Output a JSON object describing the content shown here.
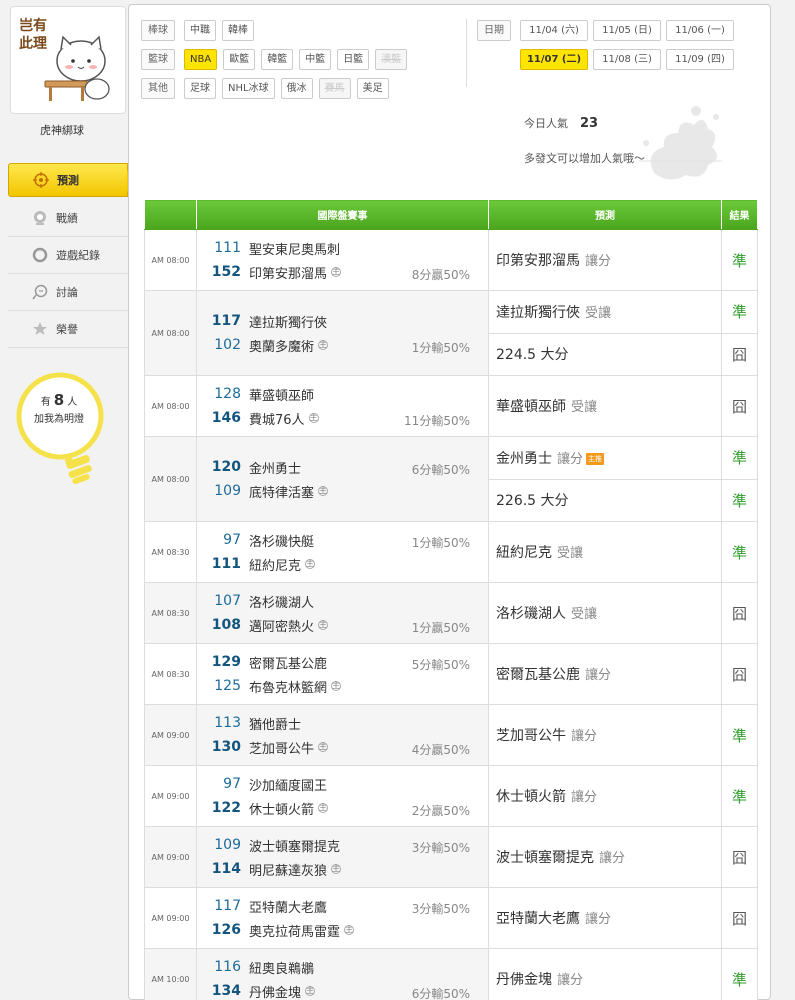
{
  "sidebar": {
    "avatar_text": "岂有此理",
    "username": "虎神綁球",
    "nav": [
      {
        "label": "預測",
        "icon": "target-icon",
        "active": true
      },
      {
        "label": "戰績",
        "icon": "trophy-icon",
        "active": false
      },
      {
        "label": "遊戲紀錄",
        "icon": "ring-icon",
        "active": false
      },
      {
        "label": "討論",
        "icon": "discussion-icon",
        "active": false
      },
      {
        "label": "榮譽",
        "icon": "star-icon",
        "active": false
      }
    ],
    "lamp": {
      "prefix": "有",
      "count": "8",
      "suffix": "人",
      "line2": "加我為明燈"
    }
  },
  "filters": [
    {
      "label": "棒球",
      "items": [
        {
          "text": "中職"
        },
        {
          "text": "韓棒"
        }
      ]
    },
    {
      "label": "籃球",
      "items": [
        {
          "text": "NBA",
          "selected": true
        },
        {
          "text": "歐籃"
        },
        {
          "text": "韓籃"
        },
        {
          "text": "中籃"
        },
        {
          "text": "日籃"
        },
        {
          "text": "澳籃",
          "disabled": true
        }
      ]
    },
    {
      "label": "其他",
      "items": [
        {
          "text": "足球"
        },
        {
          "text": "NHL冰球"
        },
        {
          "text": "俄冰"
        },
        {
          "text": "賽馬",
          "disabled": true
        },
        {
          "text": "美足"
        }
      ]
    }
  ],
  "dates": {
    "label": "日期",
    "row1": [
      {
        "text": "11/04 (六)"
      },
      {
        "text": "11/05 (日)"
      },
      {
        "text": "11/06 (一)"
      }
    ],
    "row2": [
      {
        "text": "11/07 (二)",
        "selected": true
      },
      {
        "text": "11/08 (三)"
      },
      {
        "text": "11/09 (四)"
      }
    ]
  },
  "popularity": {
    "label": "今日人氣",
    "value": "23",
    "note": "多發文可以增加人氣哦～"
  },
  "table": {
    "headers": [
      "",
      "國際盤賽事",
      "預測",
      "結果"
    ],
    "host_mark": "主",
    "badge": "主推",
    "games": [
      {
        "time": "AM 08:00",
        "away": {
          "num": "111",
          "name": "聖安東尼奧馬刺"
        },
        "home": {
          "num": "152",
          "name": "印第安那溜馬"
        },
        "spread": "8分贏50%",
        "spread_row": 2,
        "picks": [
          {
            "team": "印第安那溜馬",
            "type": "讓分",
            "result": "準",
            "win": true
          }
        ]
      },
      {
        "time": "AM 08:00",
        "away": {
          "num": "117",
          "name": "達拉斯獨行俠"
        },
        "home": {
          "num": "102",
          "name": "奧蘭多魔術"
        },
        "spread": "1分輸50%",
        "spread_row": 2,
        "bold_away": true,
        "picks": [
          {
            "team": "達拉斯獨行俠",
            "type": "受讓",
            "result": "準",
            "win": true
          },
          {
            "team": "224.5 大分",
            "type": "",
            "result": "囧",
            "win": false
          }
        ]
      },
      {
        "time": "AM 08:00",
        "away": {
          "num": "128",
          "name": "華盛頓巫師"
        },
        "home": {
          "num": "146",
          "name": "費城76人"
        },
        "spread": "11分輸50%",
        "spread_row": 2,
        "picks": [
          {
            "team": "華盛頓巫師",
            "type": "受讓",
            "result": "囧",
            "win": false
          }
        ]
      },
      {
        "time": "AM 08:00",
        "away": {
          "num": "120",
          "name": "金州勇士"
        },
        "home": {
          "num": "109",
          "name": "底特律活塞"
        },
        "spread": "6分輸50%",
        "spread_row": 1,
        "bold_away": true,
        "picks": [
          {
            "team": "金州勇士",
            "type": "讓分",
            "badge": true,
            "result": "準",
            "win": true
          },
          {
            "team": "226.5 大分",
            "type": "",
            "result": "準",
            "win": true
          }
        ]
      },
      {
        "time": "AM 08:30",
        "away": {
          "num": "97",
          "name": "洛杉磯快艇"
        },
        "home": {
          "num": "111",
          "name": "紐約尼克"
        },
        "spread": "1分輸50%",
        "spread_row": 1,
        "picks": [
          {
            "team": "紐約尼克",
            "type": "受讓",
            "result": "準",
            "win": true
          }
        ]
      },
      {
        "time": "AM 08:30",
        "away": {
          "num": "107",
          "name": "洛杉磯湖人"
        },
        "home": {
          "num": "108",
          "name": "邁阿密熱火"
        },
        "spread": "1分贏50%",
        "spread_row": 2,
        "picks": [
          {
            "team": "洛杉磯湖人",
            "type": "受讓",
            "result": "囧",
            "win": false
          }
        ]
      },
      {
        "time": "AM 08:30",
        "away": {
          "num": "129",
          "name": "密爾瓦基公鹿"
        },
        "home": {
          "num": "125",
          "name": "布魯克林籃網"
        },
        "spread": "5分輸50%",
        "spread_row": 1,
        "bold_away": true,
        "picks": [
          {
            "team": "密爾瓦基公鹿",
            "type": "讓分",
            "result": "囧",
            "win": false
          }
        ]
      },
      {
        "time": "AM 09:00",
        "away": {
          "num": "113",
          "name": "猶他爵士"
        },
        "home": {
          "num": "130",
          "name": "芝加哥公牛"
        },
        "spread": "4分贏50%",
        "spread_row": 2,
        "picks": [
          {
            "team": "芝加哥公牛",
            "type": "讓分",
            "result": "準",
            "win": true
          }
        ]
      },
      {
        "time": "AM 09:00",
        "away": {
          "num": "97",
          "name": "沙加緬度國王"
        },
        "home": {
          "num": "122",
          "name": "休士頓火箭"
        },
        "spread": "2分贏50%",
        "spread_row": 2,
        "picks": [
          {
            "team": "休士頓火箭",
            "type": "讓分",
            "result": "準",
            "win": true
          }
        ]
      },
      {
        "time": "AM 09:00",
        "away": {
          "num": "109",
          "name": "波士頓塞爾提克"
        },
        "home": {
          "num": "114",
          "name": "明尼蘇達灰狼"
        },
        "spread": "3分輸50%",
        "spread_row": 1,
        "picks": [
          {
            "team": "波士頓塞爾提克",
            "type": "讓分",
            "result": "囧",
            "win": false
          }
        ]
      },
      {
        "time": "AM 09:00",
        "away": {
          "num": "117",
          "name": "亞特蘭大老鷹"
        },
        "home": {
          "num": "126",
          "name": "奧克拉荷馬雷霆"
        },
        "spread": "3分輸50%",
        "spread_row": 1,
        "picks": [
          {
            "team": "亞特蘭大老鷹",
            "type": "讓分",
            "result": "囧",
            "win": false
          }
        ]
      },
      {
        "time": "AM 10:00",
        "away": {
          "num": "116",
          "name": "紐奧良鵜鶘"
        },
        "home": {
          "num": "134",
          "name": "丹佛金塊"
        },
        "spread": "6分輸50%",
        "spread_row": 2,
        "picks": [
          {
            "team": "丹佛金塊",
            "type": "讓分",
            "result": "準",
            "win": true
          }
        ]
      }
    ]
  },
  "colors": {
    "accent_green": "#4aa51d",
    "accent_yellow": "#ffe400",
    "win": "#2f9d2a"
  }
}
